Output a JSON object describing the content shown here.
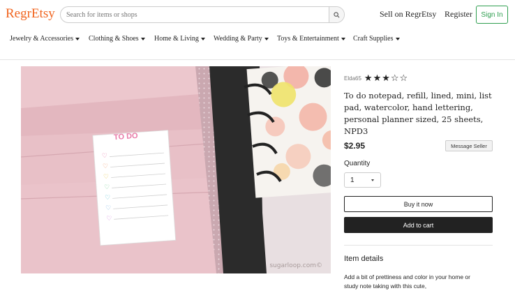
{
  "header": {
    "logo": "RegrEtsy",
    "search_placeholder": "Search for items or shops",
    "sell": "Sell on RegrEtsy",
    "register": "Register",
    "signin": "Sign In"
  },
  "categories": [
    "Jewelry & Accessories",
    "Clothing & Shoes",
    "Home & Living",
    "Wedding & Party",
    "Toys & Entertainment",
    "Craft Supplies"
  ],
  "product": {
    "photo_watermark": "sugarloop.com©",
    "notepad_heading": "TO DO",
    "seller": "Elda65",
    "rating": 3,
    "rating_max": 5,
    "title": "To do notepad, refill, lined, mini, list pad, watercolor, hand lettering, personal planner sized, 25 sheets, NPD3",
    "price": "$2.95",
    "message_seller": "Message Seller",
    "quantity_label": "Quantity",
    "quantity_value": "1",
    "buy_now": "Buy it now",
    "add_to_cart": "Add to cart",
    "details_heading": "Item details",
    "details_text": "Add a bit of prettiness and color in your home or study note taking with this cute,"
  },
  "colors": {
    "brand": "#f1641e",
    "signin_green": "#2e9e4f",
    "cart_button": "#222222"
  }
}
